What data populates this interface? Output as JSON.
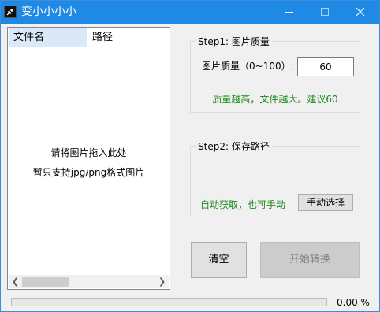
{
  "window": {
    "title": "变小小小小"
  },
  "file_list": {
    "columns": [
      "文件名",
      "路径"
    ],
    "hint_line1": "请将图片拖入此处",
    "hint_line2": "暂只支持jpg/png格式图片"
  },
  "step1": {
    "legend": "Step1: 图片质量",
    "quality_label": "图片质量（0~100）:",
    "quality_value": "60",
    "hint": "质量越高，文件越大。建议60"
  },
  "step2": {
    "legend": "Step2: 保存路径",
    "auto_text": "自动获取，也可手动",
    "manual_button": "手动选择"
  },
  "actions": {
    "clear": "清空",
    "start": "开始转换"
  },
  "progress": {
    "value": 0,
    "text": "0.00 %"
  },
  "colors": {
    "titlebar": "#1e8ae6",
    "hint_green": "#1e8a1e",
    "progress_fill": "#06b025"
  }
}
